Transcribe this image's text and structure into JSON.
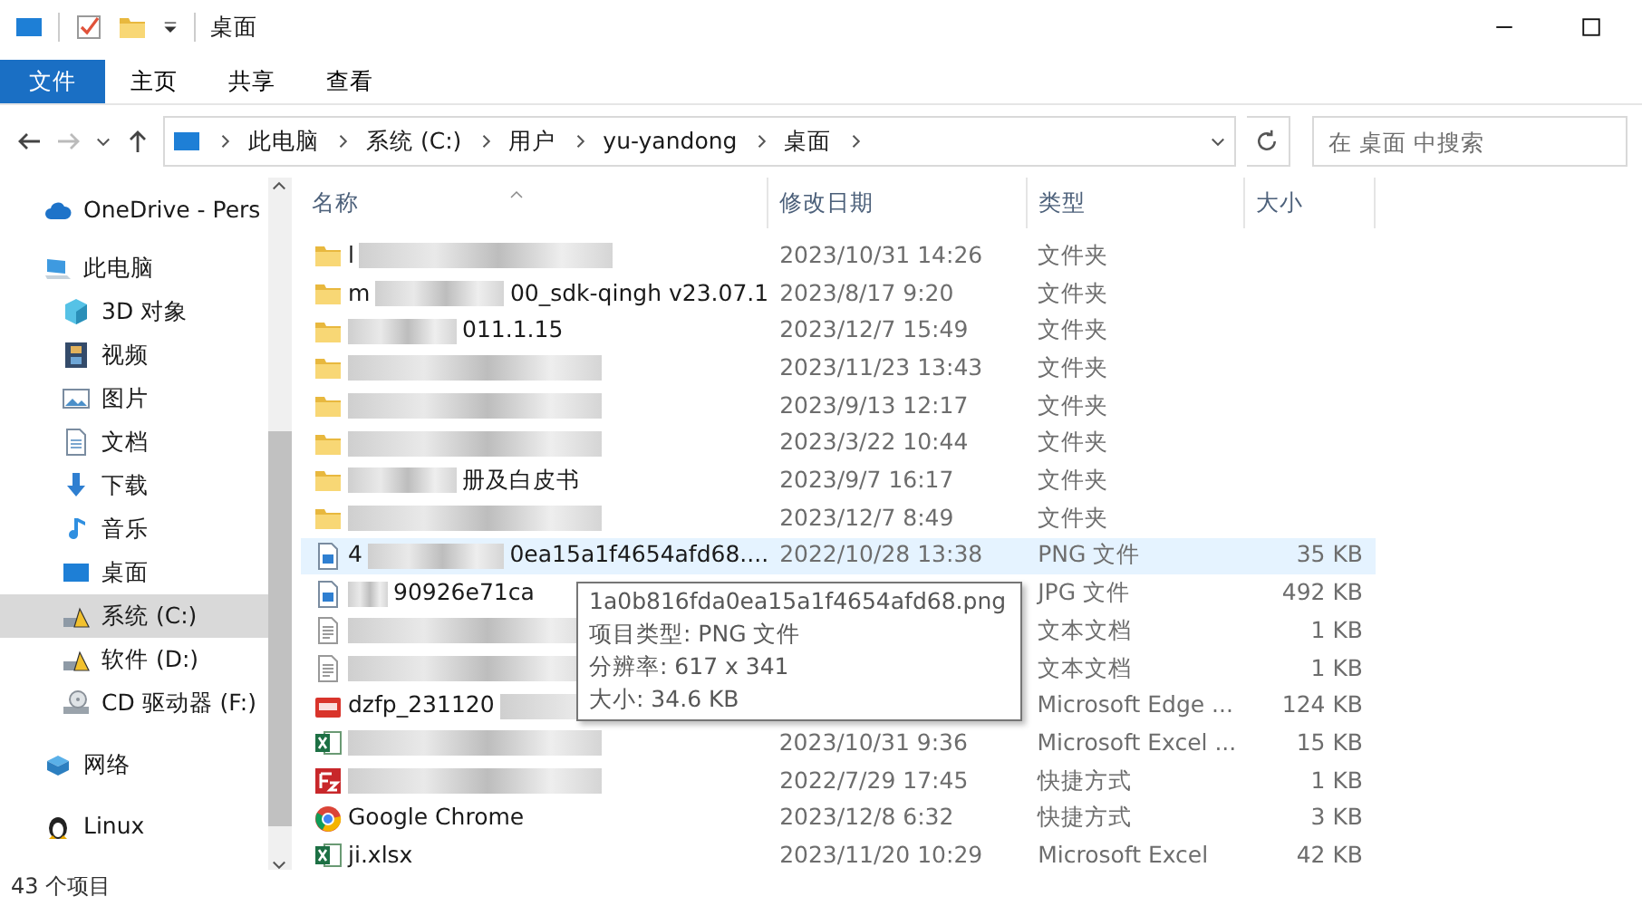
{
  "window": {
    "title": "桌面"
  },
  "ribbon_tabs": [
    {
      "label": "文件",
      "kind": "file",
      "selected": false
    },
    {
      "label": "主页",
      "kind": "tab",
      "selected": false
    },
    {
      "label": "共享",
      "kind": "tab",
      "selected": false
    },
    {
      "label": "查看",
      "kind": "tab",
      "selected": false
    }
  ],
  "address": {
    "crumbs": [
      "此电脑",
      "系统 (C:)",
      "用户",
      "yu-yandong",
      "桌面"
    ]
  },
  "search": {
    "placeholder": "在 桌面 中搜索"
  },
  "sidebar": {
    "items": [
      {
        "label": "OneDrive - Pers",
        "kind": "cloud",
        "selected": false
      },
      {
        "label": "此电脑",
        "kind": "pc",
        "selected": false,
        "children": [
          {
            "label": "3D 对象",
            "kind": "cube",
            "selected": false
          },
          {
            "label": "视频",
            "kind": "film",
            "selected": false
          },
          {
            "label": "图片",
            "kind": "picture",
            "selected": false
          },
          {
            "label": "文档",
            "kind": "document",
            "selected": false
          },
          {
            "label": "下载",
            "kind": "download",
            "selected": false
          },
          {
            "label": "音乐",
            "kind": "music",
            "selected": false
          },
          {
            "label": "桌面",
            "kind": "desktop",
            "selected": false
          },
          {
            "label": "系统 (C:)",
            "kind": "drive",
            "selected": true
          },
          {
            "label": "软件 (D:)",
            "kind": "drive",
            "selected": false
          },
          {
            "label": "CD 驱动器 (F:)",
            "kind": "cd",
            "selected": false
          }
        ]
      },
      {
        "label": "网络",
        "kind": "network",
        "selected": false
      },
      {
        "label": "Linux",
        "kind": "penguin",
        "selected": false
      }
    ]
  },
  "columns": [
    "名称",
    "修改日期",
    "类型",
    "大小"
  ],
  "files": [
    {
      "kind": "folder",
      "name": "l",
      "blurred": true,
      "modified": "2023/10/31 14:26",
      "type": "文件夹",
      "selected": false
    },
    {
      "kind": "folder",
      "name": "m",
      "blurred": true,
      "name_end": "00_sdk-qingh v23.07.1",
      "modified": "2023/8/17 9:20",
      "type": "文件夹",
      "selected": false
    },
    {
      "kind": "folder",
      "blurred": true,
      "name_end": "011.1.15",
      "modified": "2023/12/7 15:49",
      "type": "文件夹",
      "selected": false
    },
    {
      "kind": "folder",
      "blurred": true,
      "modified": "2023/11/23 13:43",
      "type": "文件夹",
      "selected": false
    },
    {
      "kind": "folder",
      "blurred": true,
      "modified": "2023/9/13 12:17",
      "type": "文件夹",
      "selected": false
    },
    {
      "kind": "folder",
      "blurred": true,
      "modified": "2023/3/22 10:44",
      "type": "文件夹",
      "selected": false
    },
    {
      "kind": "folder",
      "blurred": true,
      "name_end": "册及白皮书",
      "modified": "2023/9/7 16:17",
      "type": "文件夹",
      "selected": false
    },
    {
      "kind": "folder",
      "blurred": true,
      "modified": "2023/12/7 8:49",
      "type": "文件夹",
      "selected": false
    },
    {
      "kind": "image",
      "name": "4",
      "blurred": true,
      "name_end": "0ea15a1f4654afd68....",
      "modified": "2022/10/28 13:38",
      "type": "PNG 文件",
      "size": "35 KB",
      "selected": true
    },
    {
      "kind": "image",
      "blurred": true,
      "name_end": "90926e71ca",
      "type": "JPG 文件",
      "size": "492 KB",
      "selected": false
    },
    {
      "kind": "text",
      "blurred": true,
      "type": "文本文档",
      "size": "1 KB",
      "selected": false
    },
    {
      "kind": "text",
      "blurred": true,
      "type": "文本文档",
      "size": "1 KB",
      "selected": false
    },
    {
      "kind": "pdf",
      "name": "dzfp_231120",
      "blurred": true,
      "type": "Microsoft Edge ...",
      "size": "124 KB",
      "selected": false
    },
    {
      "kind": "excel",
      "blurred": true,
      "modified": "2023/10/31 9:36",
      "type": "Microsoft Excel ...",
      "size": "15 KB",
      "selected": false
    },
    {
      "kind": "ftp",
      "blurred": true,
      "modified": "2022/7/29 17:45",
      "type": "快捷方式",
      "size": "1 KB",
      "selected": false
    },
    {
      "kind": "chrome",
      "name": "Google Chrome",
      "blurred": false,
      "modified": "2023/12/8 6:32",
      "type": "快捷方式",
      "size": "3 KB",
      "selected": false
    },
    {
      "kind": "excel",
      "name": "ji.xlsx",
      "blurred": false,
      "modified": "2023/11/20 10:29",
      "type": "Microsoft Excel",
      "size": "42 KB",
      "selected": false
    }
  ],
  "tooltip": {
    "lines": [
      "1a0b816fda0ea15a1f4654afd68.png",
      "项目类型: PNG 文件",
      "分辨率: 617 x 341",
      "大小: 34.6 KB"
    ]
  },
  "status_bar": "43 个项目"
}
